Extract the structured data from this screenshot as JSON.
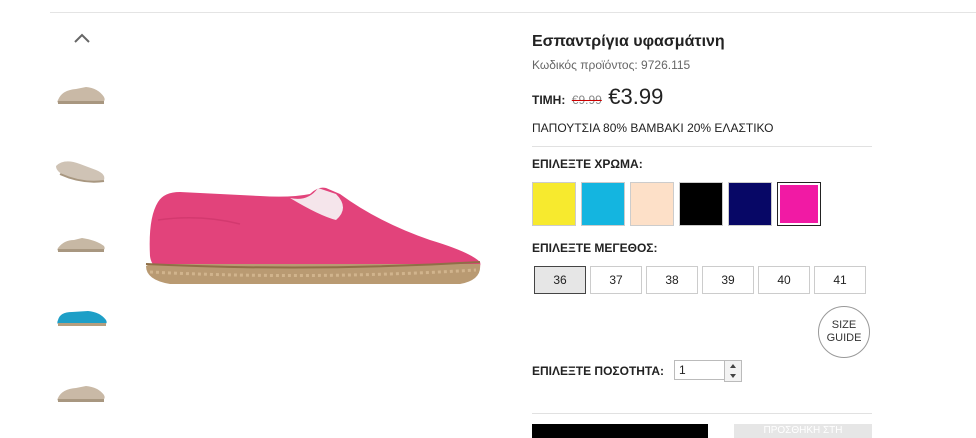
{
  "product": {
    "title": "Εσπαντρίγια υφασμάτινη",
    "code_label": "Κωδικός προϊόντος:",
    "code_value": "9726.115",
    "price_label": "ΤΙΜΗ:",
    "old_price": "€9.99",
    "new_price": "€3.99",
    "description": "ΠΑΠΟΥΤΣΙΑ 80% ΒΑΜΒΑΚΙ 20% ΕΛΑΣΤΙΚΟ",
    "image_color": "#e2437b"
  },
  "thumbnails": [
    {
      "icon": "espadrille-beige-thumbnail",
      "color": "#c9b9a6"
    },
    {
      "icon": "espadrille-beige-thumbnail",
      "color": "#cfc3b5"
    },
    {
      "icon": "espadrille-beige-thumbnail",
      "color": "#c7b8a4"
    },
    {
      "icon": "espadrille-blue-thumbnail",
      "color": "#1e9fc7"
    },
    {
      "icon": "espadrille-beige-thumbnail",
      "color": "#c9b9a6"
    }
  ],
  "color_section": {
    "label": "ΕΠΙΛΕΞΤΕ ΧΡΩΜΑ:",
    "swatches": [
      {
        "name": "yellow",
        "color": "#f7ea2e",
        "selected": false
      },
      {
        "name": "cyan",
        "color": "#14b5e0",
        "selected": false
      },
      {
        "name": "peach",
        "color": "#fde0c8",
        "selected": false
      },
      {
        "name": "black",
        "color": "#000000",
        "selected": false
      },
      {
        "name": "navy",
        "color": "#070766",
        "selected": false
      },
      {
        "name": "pink",
        "color": "#f11aa4",
        "selected": true
      }
    ]
  },
  "size_section": {
    "label": "ΕΠΙΛΕΞΤΕ ΜΕΓΕΘΟΣ:",
    "sizes": [
      "36",
      "37",
      "38",
      "39",
      "40",
      "41"
    ],
    "selected": "36",
    "guide_line1": "SIZE",
    "guide_line2": "GUIDE"
  },
  "quantity_section": {
    "label": "ΕΠΙΛΕΞΤΕ ΠΟΣΟΤΗΤΑ:",
    "value": "1"
  },
  "actions": {
    "add_to_bag_label": "",
    "secondary_label": "ΠΡΟΣΘΗΚΗ ΣΤΗ"
  }
}
